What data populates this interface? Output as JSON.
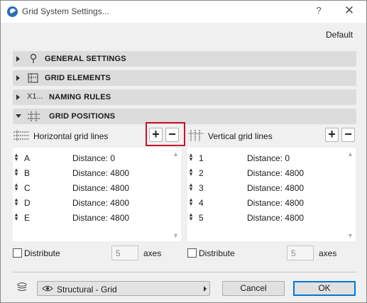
{
  "window": {
    "title": "Grid System Settings...",
    "help_label": "?",
    "close_label": "✕"
  },
  "default_label": "Default",
  "sections": [
    {
      "label": "GENERAL SETTINGS",
      "icon": "pin-icon",
      "expanded": false
    },
    {
      "label": "GRID ELEMENTS",
      "icon": "grid-elements-icon",
      "expanded": false
    },
    {
      "label": "NAMING RULES",
      "icon": "naming-icon",
      "icon_text": "X1...",
      "expanded": false
    },
    {
      "label": "GRID POSITIONS",
      "icon": "grid-positions-icon",
      "expanded": true
    }
  ],
  "horizontal": {
    "label": "Horizontal grid lines",
    "add_label": "+",
    "remove_label": "−",
    "rows": [
      {
        "name": "A",
        "distance": "Distance: 0"
      },
      {
        "name": "B",
        "distance": "Distance: 4800"
      },
      {
        "name": "C",
        "distance": "Distance: 4800"
      },
      {
        "name": "D",
        "distance": "Distance: 4800"
      },
      {
        "name": "E",
        "distance": "Distance: 4800"
      }
    ],
    "distribute_label": "Distribute",
    "axes_value": "5",
    "axes_label": "axes"
  },
  "vertical": {
    "label": "Vertical grid lines",
    "add_label": "+",
    "remove_label": "−",
    "rows": [
      {
        "name": "1",
        "distance": "Distance: 0"
      },
      {
        "name": "2",
        "distance": "Distance: 4800"
      },
      {
        "name": "3",
        "distance": "Distance: 4800"
      },
      {
        "name": "4",
        "distance": "Distance: 4800"
      },
      {
        "name": "5",
        "distance": "Distance: 4800"
      }
    ],
    "distribute_label": "Distribute",
    "axes_value": "5",
    "axes_label": "axes"
  },
  "footer": {
    "layer_value": "Structural - Grid",
    "cancel_label": "Cancel",
    "ok_label": "OK"
  },
  "colors": {
    "highlight": "#c8102e",
    "ok_border": "#0078d7"
  }
}
